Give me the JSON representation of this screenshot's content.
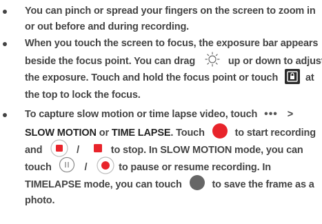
{
  "bullets": [
    {
      "lines": [
        "You can pinch or spread your fingers on the screen to zoom in",
        "or out before and during recording."
      ]
    },
    {
      "line1": "When you touch the screen to focus, the exposure bar appears",
      "line2_a": "beside the focus point. You can drag",
      "line2_b": "up or down to adjust",
      "line3": "the exposure. Touch and hold the focus point or touch",
      "line3_b": "at",
      "line4": "the top to lock the focus."
    },
    {
      "line1_a": "To capture slow motion or time lapse video, touch",
      "line1_b": ">",
      "line2_a": "SLOW MOTION",
      "line2_b": "or",
      "line2_c": "TIME LAPSE",
      "line2_d": ". Touch",
      "line2_e": "to start recording",
      "line3_a": "and",
      "line3_b": "/",
      "line3_c": "to stop. In SLOW MOTION mode, you can",
      "line4_a": "touch",
      "line4_b": "/",
      "line4_c": "to pause or resume recording. In",
      "line5_a": "TIMELAPSE mode, you can touch",
      "line5_b": "to save the frame as a",
      "line6": "photo."
    }
  ],
  "icons": {
    "exposure": "sun-icon",
    "lock": "lock-icon",
    "more": "more-dots-icon",
    "record": "record-icon",
    "stop_square": "stop-icon",
    "stop_small": "stop-small-icon",
    "pause": "pause-icon",
    "resume": "resume-icon",
    "capture": "capture-icon"
  },
  "colors": {
    "text": "#444444",
    "record_red": "#e8242b"
  }
}
